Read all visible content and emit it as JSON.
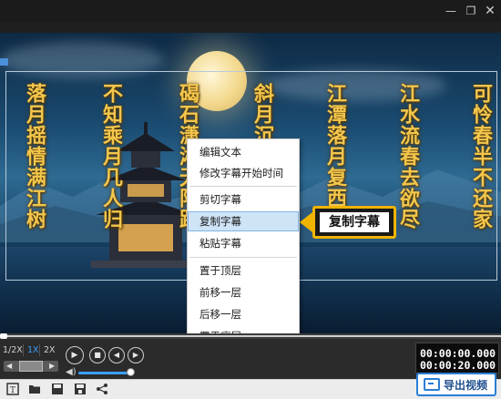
{
  "window": {
    "minimize_icon": "minimize-icon",
    "maximize_icon": "restore-icon",
    "close_icon": "close-icon"
  },
  "subtitles": {
    "columns": [
      "落月摇情满江树",
      "不知乘月几人归",
      "碣石潇湘无限路",
      "斜月沉沉藏海雾",
      "江潭落月复西斜",
      "江水流春去欲尽",
      "可怜春半不还家"
    ],
    "text_color": "#f3c64c"
  },
  "context_menu": {
    "items": [
      {
        "label": "编辑文本"
      },
      {
        "label": "修改字幕开始时间"
      },
      {
        "label": "剪切字幕"
      },
      {
        "label": "复制字幕"
      },
      {
        "label": "粘贴字幕"
      },
      {
        "label": "置于顶层"
      },
      {
        "label": "前移一层"
      },
      {
        "label": "后移一层"
      },
      {
        "label": "置于底层"
      }
    ],
    "highlighted": "复制字幕",
    "highlight_color": "#cfe4f7"
  },
  "callout": {
    "label": "复制字幕",
    "border_color": "#f0b400"
  },
  "playback": {
    "speeds": [
      "1/2X",
      "1X",
      "2X"
    ],
    "active_speed": "1X",
    "current_time": "00:00:00.000",
    "total_time": "00:00:20.000",
    "progress": 0,
    "volume": 0.9
  },
  "toolbar": {
    "icons": [
      "subtitle-style-icon",
      "folder-open-icon",
      "save-icon",
      "save-as-icon",
      "share-icon"
    ],
    "export_label": "导出视频",
    "accent": "#2a7ed6"
  }
}
